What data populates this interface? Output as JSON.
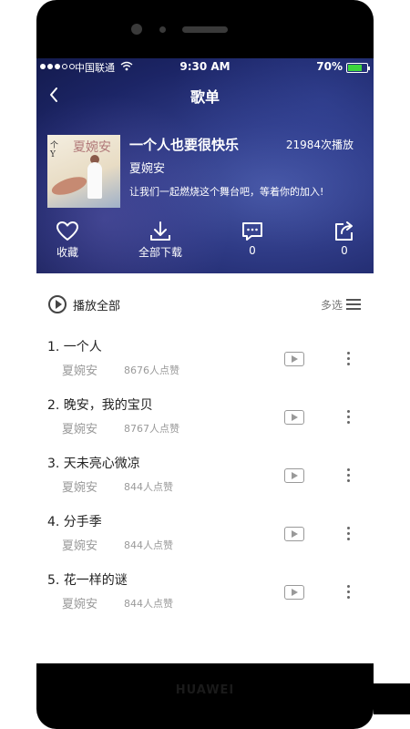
{
  "status_bar": {
    "carrier": "中国联通",
    "time": "9:30 AM",
    "battery": "70%"
  },
  "nav": {
    "title": "歌单"
  },
  "playlist": {
    "title": "一个人也要很快乐",
    "plays": "21984次播放",
    "artist": "夏婉安",
    "description": "让我们一起燃烧这个舞台吧，等着你的加入!",
    "cover_text_left": "个\nY",
    "cover_text_name": "夏婉安"
  },
  "actions": {
    "favorite": "收藏",
    "download_all": "全部下载",
    "comments": "0",
    "share": "0"
  },
  "toolbar": {
    "play_all": "播放全部",
    "multi_select": "多选"
  },
  "songs": [
    {
      "title": "1. 一个人",
      "artist": "夏婉安",
      "likes": "8676人点赞"
    },
    {
      "title": "2. 晚安，我的宝贝",
      "artist": "夏婉安",
      "likes": "8767人点赞"
    },
    {
      "title": "3. 天未亮心微凉",
      "artist": "夏婉安",
      "likes": "844人点赞"
    },
    {
      "title": "4. 分手季",
      "artist": "夏婉安",
      "likes": "844人点赞"
    },
    {
      "title": "5. 花一样的谜",
      "artist": "夏婉安",
      "likes": "844人点赞"
    }
  ],
  "device": {
    "brand": "HUAWEI"
  },
  "colors": {
    "header_bg": "#1c2566",
    "battery_fill": "#3cd43c"
  }
}
